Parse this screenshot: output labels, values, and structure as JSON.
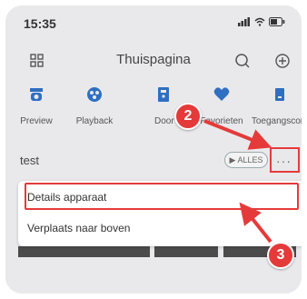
{
  "status": {
    "time": "15:35"
  },
  "header": {
    "title": "Thuispagina"
  },
  "shortcuts": [
    {
      "label": "Preview",
      "icon": "camera-icon"
    },
    {
      "label": "Playback",
      "icon": "playback-icon"
    },
    {
      "label": "Door",
      "icon": "door-icon"
    },
    {
      "label": "Favorieten",
      "icon": "heart-icon"
    },
    {
      "label": "Toegangscont",
      "icon": "access-icon"
    }
  ],
  "section": {
    "title": "test",
    "alles_label": "▶ ALLES",
    "more": "···"
  },
  "menu": {
    "items": [
      {
        "label": "Details apparaat"
      },
      {
        "label": "Verplaats naar boven"
      }
    ]
  },
  "annotations": {
    "badge_2": "2",
    "badge_3": "3"
  },
  "colors": {
    "accent": "#2f6fc1",
    "annotation": "#e53a3a",
    "overlay": "#e9e9ec"
  }
}
